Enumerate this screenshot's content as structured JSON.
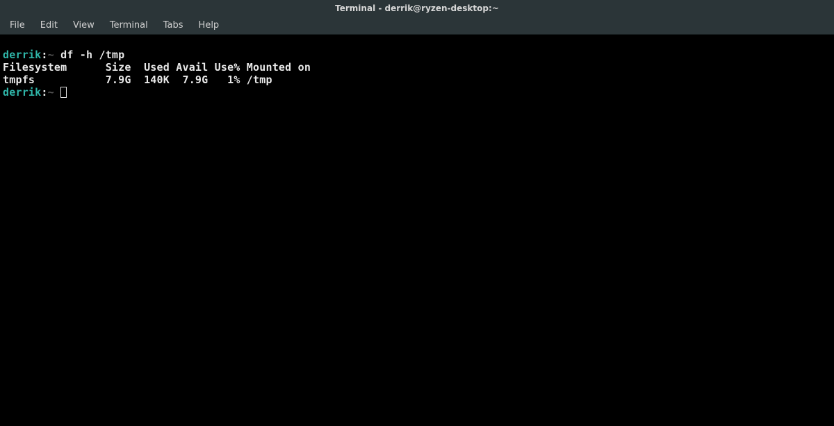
{
  "titlebar": {
    "title": "Terminal - derrik@ryzen-desktop:~"
  },
  "menubar": {
    "items": [
      {
        "label": "File"
      },
      {
        "label": "Edit"
      },
      {
        "label": "View"
      },
      {
        "label": "Terminal"
      },
      {
        "label": "Tabs"
      },
      {
        "label": "Help"
      }
    ]
  },
  "terminal": {
    "prompt1": {
      "user": "derrik",
      "sep": ":",
      "path": "~",
      "command": " df -h /tmp"
    },
    "output_header": "Filesystem      Size  Used Avail Use% Mounted on",
    "output_row": "tmpfs           7.9G  140K  7.9G   1% /tmp",
    "prompt2": {
      "user": "derrik",
      "sep": ":",
      "path": "~",
      "command": " "
    }
  }
}
